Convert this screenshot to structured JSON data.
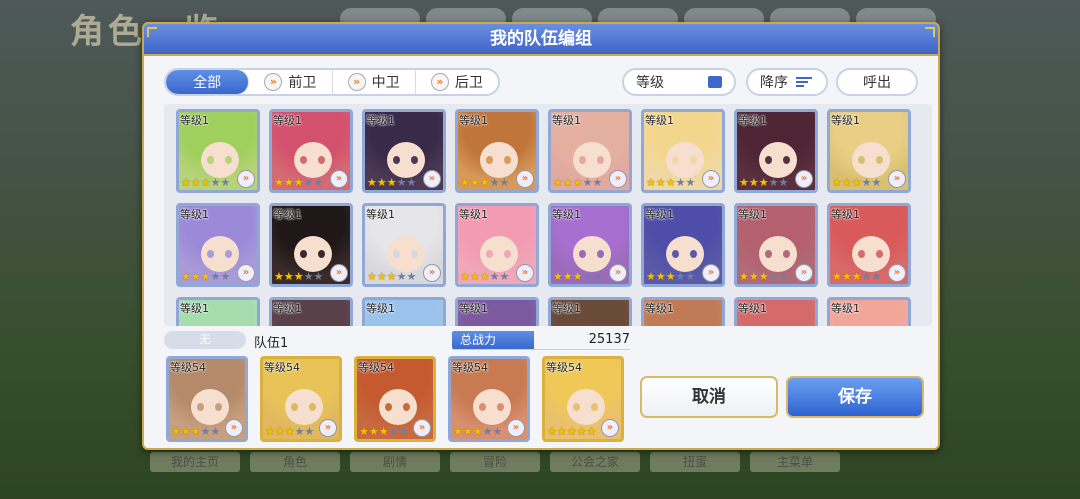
{
  "background": {
    "title": "角色一览",
    "bottom_nav": [
      "我的主页",
      "角色",
      "剧情",
      "冒险",
      "公会之家",
      "扭蛋",
      "主菜单"
    ]
  },
  "dialog": {
    "title": "我的队伍编组",
    "filters": [
      {
        "label": "全部",
        "active": true,
        "icon": ""
      },
      {
        "label": "前卫",
        "active": false,
        "icon": "position-arrow-icon"
      },
      {
        "label": "中卫",
        "active": false,
        "icon": "position-arrow-icon"
      },
      {
        "label": "后卫",
        "active": false,
        "icon": "position-arrow-icon"
      }
    ],
    "level_label": "等级",
    "sort_label": "降序",
    "out_label": "呼出"
  },
  "roster": {
    "level_label": "等级1",
    "cards": [
      {
        "level": "等级1",
        "stars": 3,
        "art": "#b8d37a",
        "hair": "#9fcf5c"
      },
      {
        "level": "等级1",
        "stars": 3,
        "art": "#d36b74",
        "hair": "#d4516d"
      },
      {
        "level": "等级1",
        "stars": 3,
        "art": "#4a3a55",
        "hair": "#3a2a4a"
      },
      {
        "level": "等级1",
        "stars": 3,
        "art": "#d79a5a",
        "hair": "#c0763a"
      },
      {
        "level": "等级1",
        "stars": 3,
        "art": "#e3a9a0",
        "hair": "#e4b0a0"
      },
      {
        "level": "等级1",
        "stars": 3,
        "art": "#f0d8a8",
        "hair": "#f3d68e"
      },
      {
        "level": "等级1",
        "stars": 3,
        "art": "#5a3040",
        "hair": "#4d2535"
      },
      {
        "level": "等级1",
        "stars": 3,
        "art": "#d9c070",
        "hair": "#e8cf85"
      },
      {
        "level": "等级1",
        "stars": 3,
        "art": "#a99bd8",
        "hair": "#9c8ad8"
      },
      {
        "level": "等级1",
        "stars": 3,
        "art": "#3a2a2a",
        "hair": "#201818"
      },
      {
        "level": "等级1",
        "stars": 3,
        "art": "#d8d8dc",
        "hair": "#e6e6ea"
      },
      {
        "level": "等级1",
        "stars": 3,
        "art": "#f0a8b8",
        "hair": "#f29bb3"
      },
      {
        "level": "等级1",
        "stars": 3,
        "art": "#9a6bb8",
        "hair": "#a76fd0"
      },
      {
        "level": "等级1",
        "stars": 3,
        "art": "#5a5aa8",
        "hair": "#4e4ea8"
      },
      {
        "level": "等级1",
        "stars": 3,
        "art": "#b06a78",
        "hair": "#b4606f"
      },
      {
        "level": "等级1",
        "stars": 3,
        "art": "#d86a6a",
        "hair": "#d95a5a"
      },
      {
        "level": "等级1",
        "stars": 3,
        "art": "#b8e0c0",
        "hair": "#a6dcae"
      },
      {
        "level": "等级1",
        "stars": 3,
        "art": "#6a5058",
        "hair": "#5a4048"
      },
      {
        "level": "等级1",
        "stars": 3,
        "art": "#a8c8e8",
        "hair": "#9bc3ec"
      },
      {
        "level": "等级1",
        "stars": 3,
        "art": "#8a6aa8",
        "hair": "#7c5aa0"
      },
      {
        "level": "等级1",
        "stars": 3,
        "art": "#7a5a48",
        "hair": "#6a4a38"
      },
      {
        "level": "等级1",
        "stars": 3,
        "art": "#c89068",
        "hair": "#c07a55"
      },
      {
        "level": "等级1",
        "stars": 3,
        "art": "#d87a7a",
        "hair": "#d46a6a"
      },
      {
        "level": "等级1",
        "stars": 3,
        "art": "#f0b0a8",
        "hair": "#f2a69a"
      }
    ]
  },
  "team_info": {
    "slot_badge": "无",
    "team_name": "队伍1",
    "power_label": "总战力",
    "power_value": "25137"
  },
  "team": [
    {
      "level": "等级54",
      "stars": 3,
      "frame": "blue",
      "art": "#c8a080",
      "hair": "#b58a6a"
    },
    {
      "level": "等级54",
      "stars": 3,
      "frame": "gold",
      "art": "#e0b860",
      "hair": "#e8c458"
    },
    {
      "level": "等级54",
      "stars": 3,
      "frame": "gold",
      "art": "#c86a40",
      "hair": "#c55a30"
    },
    {
      "level": "等级54",
      "stars": 3,
      "frame": "blue",
      "art": "#d89070",
      "hair": "#c87a50"
    },
    {
      "level": "等级54",
      "stars": 5,
      "frame": "gold",
      "art": "#e8c070",
      "hair": "#f0c858"
    }
  ],
  "actions": {
    "cancel_label": "取消",
    "save_label": "保存"
  }
}
